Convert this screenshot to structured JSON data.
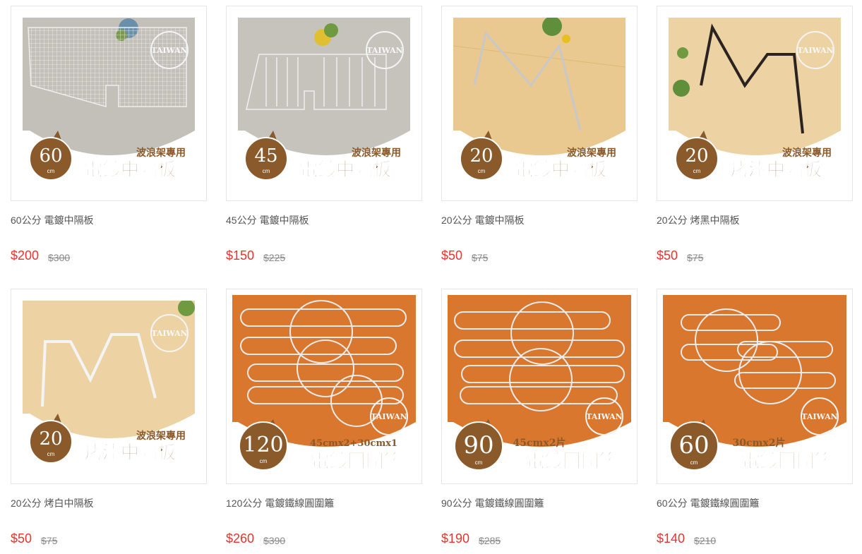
{
  "products": [
    {
      "name": "60公分 電鍍中隔板",
      "price": "$200",
      "original_price": "$300",
      "badge": {
        "number": "60",
        "unit": "cm",
        "subtitle": "波浪架專用",
        "title": "電鍍中隔板",
        "seal": "TAIWAN"
      }
    },
    {
      "name": "45公分 電鍍中隔板",
      "price": "$150",
      "original_price": "$225",
      "badge": {
        "number": "45",
        "unit": "cm",
        "subtitle": "波浪架專用",
        "title": "電鍍中隔板",
        "seal": "TAIWAN"
      }
    },
    {
      "name": "20公分 電鍍中隔板",
      "price": "$50",
      "original_price": "$75",
      "badge": {
        "number": "20",
        "unit": "cm",
        "subtitle": "波浪架專用",
        "title": "電鍍中隔板",
        "seal": "TAIWAN"
      }
    },
    {
      "name": "20公分 烤黑中隔板",
      "price": "$50",
      "original_price": "$75",
      "badge": {
        "number": "20",
        "unit": "cm",
        "subtitle": "波浪架專用",
        "title": "烤漆中隔板",
        "seal": "TAIWAN"
      }
    },
    {
      "name": "20公分 烤白中隔板",
      "price": "$50",
      "original_price": "$75",
      "badge": {
        "number": "20",
        "unit": "cm",
        "subtitle": "波浪架專用",
        "title": "烤漆中隔板",
        "seal": "TAIWAN"
      }
    },
    {
      "name": "120公分 電鍍鐵線圓圍籬",
      "price": "$260",
      "original_price": "$390",
      "badge": {
        "number": "120",
        "unit": "cm",
        "subtitle": "45cmx2+30cmx1",
        "title": "電鍍圓圍籬",
        "seal": "TAIWAN"
      }
    },
    {
      "name": "90公分 電鍍鐵線圓圍籬",
      "price": "$190",
      "original_price": "$285",
      "badge": {
        "number": "90",
        "unit": "cm",
        "subtitle": "45cmx2片",
        "title": "電鍍圓圍籬",
        "seal": "TAIWAN"
      }
    },
    {
      "name": "60公分 電鍍鐵線圓圍籬",
      "price": "$140",
      "original_price": "$210",
      "badge": {
        "number": "60",
        "unit": "cm",
        "subtitle": "30cmx2片",
        "title": "電鍍圓圍籬",
        "seal": "TAIWAN"
      }
    }
  ],
  "colors": {
    "price": "#e8332d",
    "original_price": "#888888",
    "badge_brown": "#8a5a2b",
    "concrete": "#bdbab4",
    "wood_light": "#e9c98f",
    "wood_orange": "#d9772e"
  }
}
